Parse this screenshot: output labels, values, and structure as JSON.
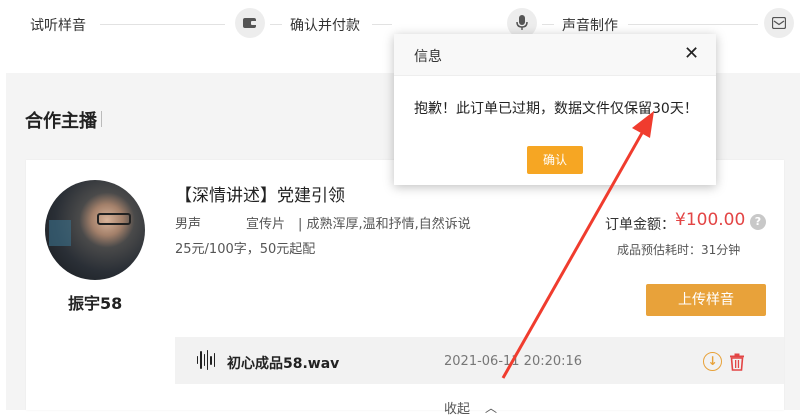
{
  "steps": {
    "items": [
      {
        "label": "试听样音"
      },
      {
        "label": "确认并付款"
      },
      {
        "label": "声音制作"
      }
    ]
  },
  "section": {
    "title": "合作主播"
  },
  "anchor": {
    "name": "振宇58",
    "title": "【深情讲述】党建引领",
    "gender": "男声",
    "category": "宣传片",
    "styles": "| 成熟浑厚,温和抒情,自然诉说",
    "price": "25元/100字，50元起配",
    "order_label": "订单金额：",
    "order_amount": "¥100.00",
    "help": "?",
    "eta": "成品预估耗时：31分钟",
    "upload_label": "上传样音"
  },
  "file": {
    "name": "初心成品58.wav",
    "time": "2021-06-11 20:20:16",
    "download_glyph": "↓"
  },
  "collapse": {
    "label": "收起",
    "chevron": "︿"
  },
  "dialog": {
    "title": "信息",
    "close": "✕",
    "message": "抱歉！此订单已过期，数据文件仅保留30天！",
    "ok_label": "确认"
  },
  "colors": {
    "accent": "#e8a23a",
    "price": "#e34545",
    "annotation_arrow": "#f03c2e"
  }
}
